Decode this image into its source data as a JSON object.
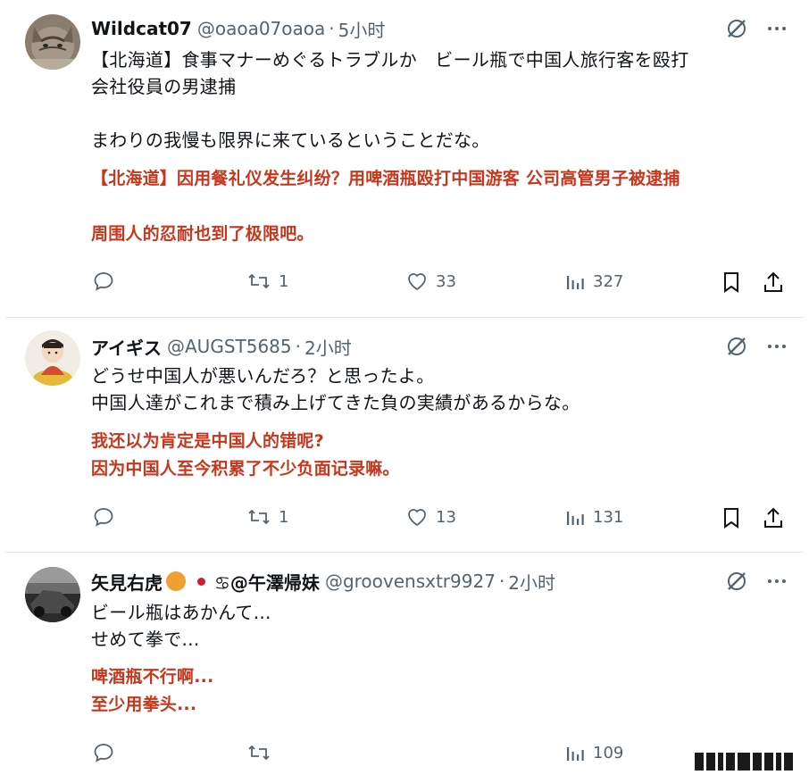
{
  "tweets": [
    {
      "name": "Wildcat07",
      "handle": "@oaoa07oaoa",
      "sep": "·",
      "time": "5小时",
      "lines": [
        "【北海道】食事マナーめぐるトラブルか　ビール瓶で中国人旅行客を殴打",
        "会社役員の男逮捕",
        "まわりの我慢も限界に来ているということだな。"
      ],
      "translation": [
        "【北海道】因用餐礼仪发生纠纷？用啤酒瓶殴打中国游客 公司高管男子被逮捕",
        "周围人的忍耐也到了极限吧。"
      ],
      "replies": "",
      "retweets": "1",
      "likes": "33",
      "views": "327"
    },
    {
      "name": "アイギス",
      "handle": "@AUGST5685",
      "sep": "·",
      "time": "2小时",
      "lines": [
        "どうせ中国人が悪いんだろ？と思ったよ。",
        "中国人達がこれまで積み上げてきた負の実績があるからな。"
      ],
      "translation": [
        "我还以为肯定是中国人的错呢?",
        "因为中国人至今积累了不少负面记录嘛。"
      ],
      "replies": "",
      "retweets": "1",
      "likes": "13",
      "views": "131"
    },
    {
      "name": "矢見右虎",
      "name_suffix": "♋@午澤帰妹",
      "handle": "@groovensxtr9927",
      "sep": "·",
      "time": "2小时",
      "lines": [
        "ビール瓶はあかんて...",
        "せめて拳で..."
      ],
      "translation": [
        "啤酒瓶不行啊...",
        "至少用拳头..."
      ],
      "replies": "",
      "retweets": "",
      "likes": "",
      "views": "109"
    }
  ],
  "icons": {
    "grok": "grok-icon",
    "more": "more-icon",
    "reply": "reply-icon",
    "retweet": "retweet-icon",
    "like": "like-icon",
    "views": "views-icon",
    "bookmark": "bookmark-icon",
    "share": "share-icon"
  },
  "colors": {
    "text": "#0f1419",
    "secondary": "#536471",
    "translation": "#c8361c",
    "divider": "#e6e8ea",
    "orange_badge": "#f0a030",
    "flag_red": "#d02030"
  }
}
